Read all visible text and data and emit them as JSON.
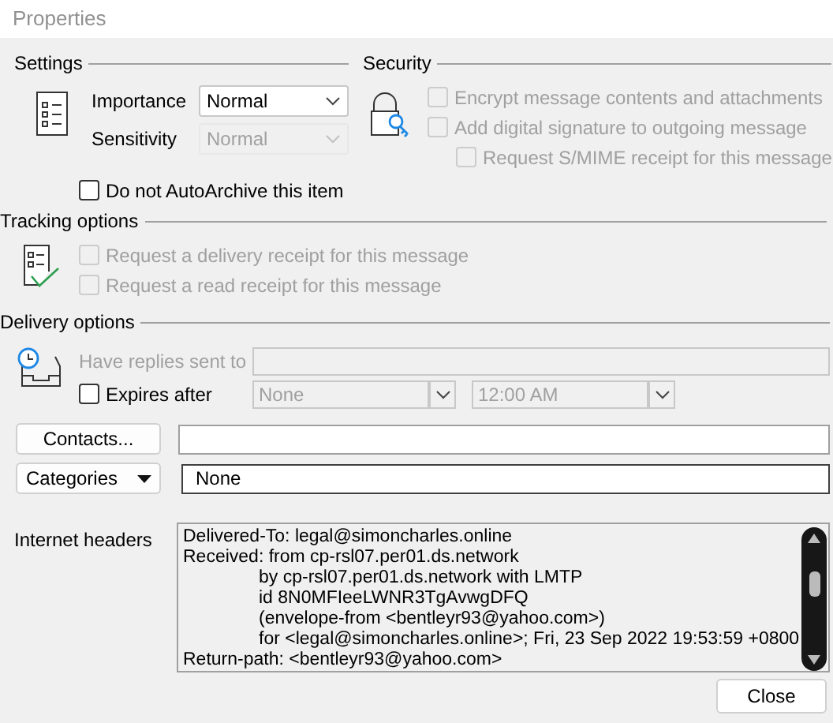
{
  "window": {
    "title": "Properties"
  },
  "settings": {
    "title": "Settings",
    "importance": {
      "label": "Importance",
      "value": "Normal",
      "disabled": false
    },
    "sensitivity": {
      "label": "Sensitivity",
      "value": "Normal",
      "disabled": true
    },
    "autoarchive": {
      "label": "Do not AutoArchive this item",
      "checked": false
    }
  },
  "security": {
    "title": "Security",
    "options": [
      {
        "label": "Encrypt message contents and attachments",
        "checked": false,
        "disabled": true,
        "nested": false
      },
      {
        "label": "Add digital signature to outgoing message",
        "checked": false,
        "disabled": true,
        "nested": false
      },
      {
        "label": "Request S/MIME receipt for this message",
        "checked": false,
        "disabled": true,
        "nested": true
      }
    ]
  },
  "tracking": {
    "title": "Tracking options",
    "options": [
      {
        "label": "Request a delivery receipt for this message",
        "checked": false,
        "disabled": true
      },
      {
        "label": "Request a read receipt for this message",
        "checked": false,
        "disabled": true
      }
    ]
  },
  "delivery": {
    "title": "Delivery options",
    "replies": {
      "label": "Have replies sent to",
      "disabled": true
    },
    "expires": {
      "label": "Expires after",
      "checked": false,
      "date": "None",
      "time": "12:00 AM"
    }
  },
  "contacts": {
    "button": "Contacts..."
  },
  "categories": {
    "button": "Categories",
    "value": "None"
  },
  "headers": {
    "label": "Internet headers",
    "lines": [
      {
        "text": "Delivered-To: legal@simoncharles.online",
        "continued": false
      },
      {
        "text": "Received: from cp-rsl07.per01.ds.network",
        "continued": false
      },
      {
        "text": "by cp-rsl07.per01.ds.network with LMTP",
        "continued": true
      },
      {
        "text": "id 8N0MFIeeLWNR3TgAvwgDFQ",
        "continued": true
      },
      {
        "text": "(envelope-from <bentleyr93@yahoo.com>)",
        "continued": true
      },
      {
        "text": "for <legal@simoncharles.online>; Fri, 23 Sep 2022 19:53:59 +0800",
        "continued": true
      },
      {
        "text": "Return-path: <bentleyr93@yahoo.com>",
        "continued": false
      }
    ]
  },
  "buttons": [
    "Close"
  ]
}
